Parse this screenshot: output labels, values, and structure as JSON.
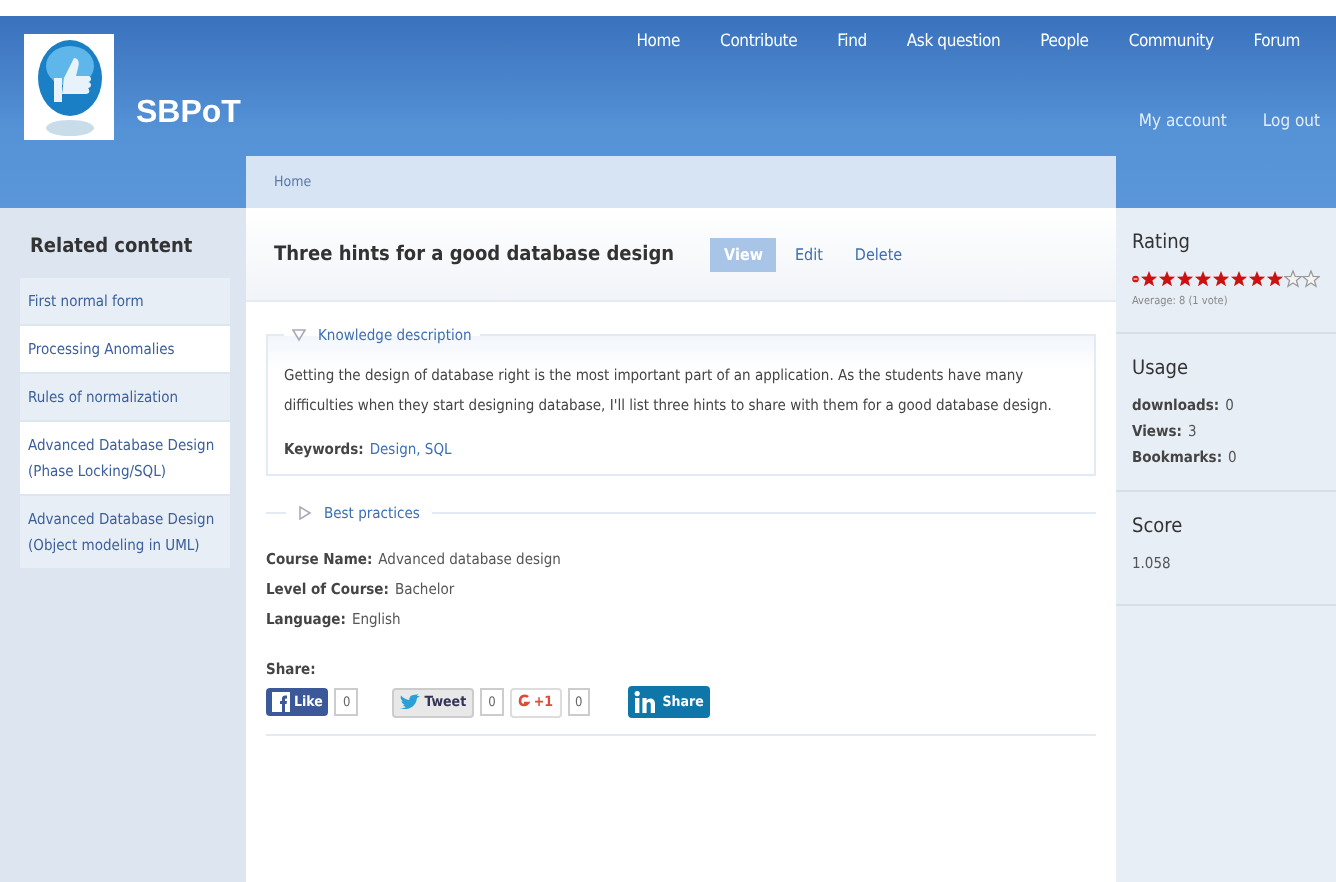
{
  "header": {
    "site_name": "SBPoT",
    "nav": [
      "Home",
      "Contribute",
      "Find",
      "Ask question",
      "People",
      "Community",
      "Forum"
    ],
    "user_links": [
      "My account",
      "Log out"
    ]
  },
  "breadcrumb": "Home",
  "sidebar": {
    "title": "Related content",
    "items": [
      "First normal form",
      "Processing Anomalies",
      "Rules of normalization",
      "Advanced Database Design (Phase Locking/SQL)",
      "Advanced Database Design (Object modeling in UML)"
    ]
  },
  "page": {
    "title": "Three hints for a good database design",
    "tabs": [
      {
        "label": "View",
        "selected": true
      },
      {
        "label": "Edit",
        "selected": false
      },
      {
        "label": "Delete",
        "selected": false
      }
    ],
    "knowledge": {
      "legend": "Knowledge description",
      "expanded": true,
      "text": "Getting the design of database right is the most important part of an application. As the students have many difficulties when they start designing database, I'll list three hints to share with them for a good database design.",
      "keywords_label": "Keywords:",
      "keywords": "Design, SQL"
    },
    "best_practices": {
      "legend": "Best practices",
      "expanded": false
    },
    "fields": [
      {
        "label": "Course Name:",
        "value": "Advanced database design"
      },
      {
        "label": "Level of Course:",
        "value": "Bachelor"
      },
      {
        "label": "Language:",
        "value": "English"
      }
    ],
    "share": {
      "label": "Share:",
      "buttons": [
        {
          "kind": "facebook",
          "label": "Like",
          "count": "0"
        },
        {
          "kind": "twitter",
          "label": "Tweet",
          "count": "0"
        },
        {
          "kind": "gplus",
          "label": "+1",
          "count": "0"
        },
        {
          "kind": "linkedin",
          "label": "Share"
        }
      ]
    }
  },
  "right": {
    "rating": {
      "title": "Rating",
      "stars": 8,
      "average": "Average: 8 (1 vote)"
    },
    "usage": {
      "title": "Usage",
      "items": [
        {
          "label": "downloads:",
          "value": "0"
        },
        {
          "label": "Views:",
          "value": "3"
        },
        {
          "label": "Bookmarks:",
          "value": "0"
        }
      ]
    },
    "score": {
      "title": "Score",
      "value": "1.058"
    }
  }
}
